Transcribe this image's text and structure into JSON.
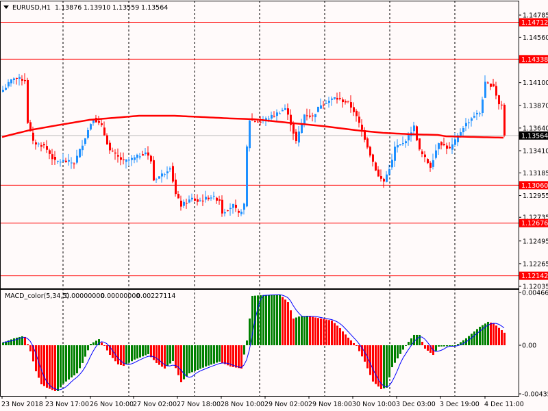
{
  "chart_data": [
    {
      "type": "candlestick",
      "title": "EURUSD,H1",
      "header_values": [
        "1.13876",
        "1.13910",
        "1.13559",
        "1.13564"
      ],
      "ylim": [
        1.12035,
        1.14785
      ],
      "y_ticks": [
        "1.14785",
        "1.14560",
        "1.14100",
        "1.13870",
        "1.13640",
        "1.13410",
        "1.13185",
        "1.12955",
        "1.12735",
        "1.12495",
        "1.12265",
        "1.12035"
      ],
      "levels": [
        "1.14712",
        "1.14338",
        "1.13060",
        "1.12676",
        "1.12142"
      ],
      "current_price": "1.13564",
      "colors": {
        "up": "#1e90ff",
        "down": "#ff0000",
        "level": "#ff0000",
        "ma": "#ff0000",
        "current": "#c0c0c0"
      },
      "bar_count": 184,
      "close_keypoints": [
        [
          0,
          1.14028
        ],
        [
          4,
          1.14153
        ],
        [
          8,
          1.14125
        ],
        [
          9,
          1.13702
        ],
        [
          11,
          1.13493
        ],
        [
          15,
          1.13459
        ],
        [
          19,
          1.13299
        ],
        [
          22,
          1.13306
        ],
        [
          26,
          1.13285
        ],
        [
          29,
          1.1348
        ],
        [
          32,
          1.13688
        ],
        [
          33,
          1.13743
        ],
        [
          36,
          1.13653
        ],
        [
          39,
          1.1341
        ],
        [
          44,
          1.13299
        ],
        [
          48,
          1.13334
        ],
        [
          52,
          1.13396
        ],
        [
          54,
          1.13306
        ],
        [
          55,
          1.13112
        ],
        [
          59,
          1.13188
        ],
        [
          61,
          1.1325
        ],
        [
          63,
          1.12966
        ],
        [
          65,
          1.12855
        ],
        [
          69,
          1.12924
        ],
        [
          71,
          1.12896
        ],
        [
          76,
          1.12945
        ],
        [
          79,
          1.1291
        ],
        [
          80,
          1.12785
        ],
        [
          84,
          1.12855
        ],
        [
          86,
          1.12764
        ],
        [
          88,
          1.12855
        ],
        [
          89,
          1.13445
        ],
        [
          90,
          1.13723
        ],
        [
          94,
          1.13702
        ],
        [
          99,
          1.13771
        ],
        [
          103,
          1.13841
        ],
        [
          105,
          1.13688
        ],
        [
          107,
          1.135
        ],
        [
          110,
          1.13778
        ],
        [
          113,
          1.13757
        ],
        [
          116,
          1.13882
        ],
        [
          119,
          1.13917
        ],
        [
          121,
          1.13945
        ],
        [
          126,
          1.13896
        ],
        [
          128,
          1.13813
        ],
        [
          131,
          1.13618
        ],
        [
          134,
          1.13375
        ],
        [
          137,
          1.13146
        ],
        [
          139,
          1.13098
        ],
        [
          142,
          1.13306
        ],
        [
          143,
          1.13445
        ],
        [
          146,
          1.1348
        ],
        [
          150,
          1.13653
        ],
        [
          152,
          1.1341
        ],
        [
          156,
          1.1325
        ],
        [
          159,
          1.135
        ],
        [
          163,
          1.13424
        ],
        [
          165,
          1.13507
        ],
        [
          168,
          1.13653
        ],
        [
          172,
          1.13771
        ],
        [
          174,
          1.13792
        ],
        [
          176,
          1.14091
        ],
        [
          179,
          1.1407
        ],
        [
          181,
          1.13882
        ],
        [
          182,
          1.13875
        ],
        [
          183,
          1.13564
        ]
      ],
      "ma_keypoints": [
        [
          0,
          1.13549
        ],
        [
          10,
          1.13618
        ],
        [
          20,
          1.13667
        ],
        [
          32,
          1.13723
        ],
        [
          50,
          1.13764
        ],
        [
          63,
          1.13764
        ],
        [
          74,
          1.1375
        ],
        [
          84,
          1.13736
        ],
        [
          92,
          1.13729
        ],
        [
          104,
          1.13695
        ],
        [
          117,
          1.1366
        ],
        [
          129,
          1.13618
        ],
        [
          139,
          1.13591
        ],
        [
          149,
          1.13577
        ],
        [
          159,
          1.1357
        ],
        [
          162,
          1.13556
        ],
        [
          183,
          1.13542
        ]
      ]
    },
    {
      "type": "bar",
      "title": "MACD_color(5,34,5)",
      "header_values": [
        "0.00000000",
        "0.00000000",
        "0.00227114"
      ],
      "ylim": [
        -0.004355,
        0.00466
      ],
      "y_ticks": [
        "0.004660",
        "0.00",
        "-0.004355"
      ],
      "colors": {
        "rising": "#008000",
        "falling": "#ff0000",
        "signal": "#0000ff"
      },
      "histogram_keypoints": [
        [
          0,
          0.00024
        ],
        [
          4,
          0.00061
        ],
        [
          7,
          0.00079
        ],
        [
          8,
          0.00073
        ],
        [
          10,
          -0.00054
        ],
        [
          12,
          -0.0023
        ],
        [
          14,
          -0.00345
        ],
        [
          16,
          -0.00375
        ],
        [
          19,
          -0.00405
        ],
        [
          20,
          -0.00405
        ],
        [
          22,
          -0.00339
        ],
        [
          27,
          -0.00248
        ],
        [
          29,
          -0.00157
        ],
        [
          32,
          0.00012
        ],
        [
          35,
          0.00054
        ],
        [
          37,
          -6e-05
        ],
        [
          39,
          -0.00085
        ],
        [
          42,
          -0.00169
        ],
        [
          44,
          -0.00182
        ],
        [
          48,
          -0.00127
        ],
        [
          53,
          -0.00079
        ],
        [
          56,
          -0.00157
        ],
        [
          59,
          -0.00206
        ],
        [
          62,
          -0.00139
        ],
        [
          65,
          -0.00327
        ],
        [
          68,
          -0.00248
        ],
        [
          74,
          -0.00188
        ],
        [
          79,
          -0.00145
        ],
        [
          83,
          -0.00188
        ],
        [
          87,
          -0.00206
        ],
        [
          89,
          0.00042
        ],
        [
          90,
          0.00236
        ],
        [
          91,
          0.00436
        ],
        [
          94,
          0.00442
        ],
        [
          101,
          0.00448
        ],
        [
          104,
          0.00381
        ],
        [
          106,
          0.00236
        ],
        [
          108,
          0.00254
        ],
        [
          111,
          0.0026
        ],
        [
          116,
          0.00236
        ],
        [
          120,
          0.00218
        ],
        [
          123,
          0.00151
        ],
        [
          126,
          0.00067
        ],
        [
          129,
          -6e-05
        ],
        [
          132,
          -0.00145
        ],
        [
          135,
          -0.00321
        ],
        [
          138,
          -0.00387
        ],
        [
          140,
          -0.00375
        ],
        [
          142,
          -0.00194
        ],
        [
          147,
          0.0
        ],
        [
          150,
          0.00091
        ],
        [
          152,
          0.00091
        ],
        [
          154,
          -0.0003
        ],
        [
          157,
          -0.00085
        ],
        [
          159,
          -0.00012
        ],
        [
          165,
          -6e-05
        ],
        [
          169,
          0.00061
        ],
        [
          174,
          0.00163
        ],
        [
          177,
          0.00206
        ],
        [
          179,
          0.00194
        ],
        [
          182,
          0.00133
        ],
        [
          183,
          0.0011
        ]
      ]
    }
  ],
  "x_ticks": [
    "23 Nov 2018",
    "23 Nov 17:00",
    "26 Nov 10:00",
    "27 Nov 02:00",
    "27 Nov 18:00",
    "28 Nov 10:00",
    "29 Nov 02:00",
    "29 Nov 18:00",
    "30 Nov 10:00",
    "3 Dec 03:00",
    "3 Dec 19:00",
    "4 Dec 11:00"
  ]
}
